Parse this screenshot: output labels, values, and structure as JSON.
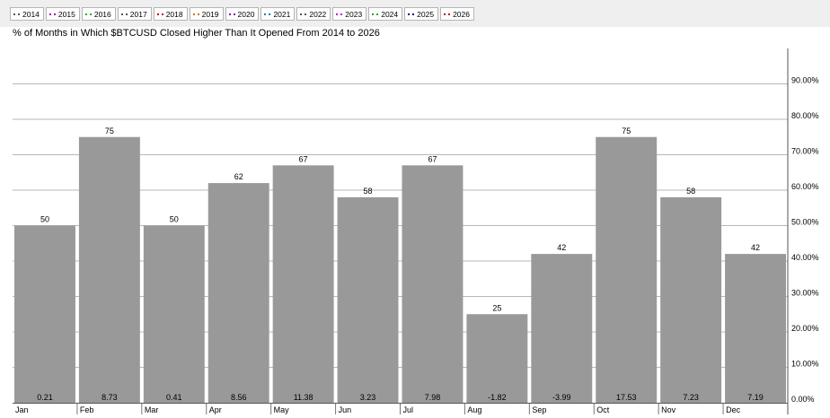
{
  "legend": [
    {
      "label": "2014",
      "color": "#555555"
    },
    {
      "label": "2015",
      "color": "#aa00aa"
    },
    {
      "label": "2016",
      "color": "#22aa22"
    },
    {
      "label": "2017",
      "color": "#555555"
    },
    {
      "label": "2018",
      "color": "#cc0000"
    },
    {
      "label": "2019",
      "color": "#cc7700"
    },
    {
      "label": "2020",
      "color": "#8800cc"
    },
    {
      "label": "2021",
      "color": "#008899"
    },
    {
      "label": "2022",
      "color": "#555555"
    },
    {
      "label": "2023",
      "color": "#cc00cc"
    },
    {
      "label": "2024",
      "color": "#22aa22"
    },
    {
      "label": "2025",
      "color": "#000088"
    },
    {
      "label": "2026",
      "color": "#cc0000"
    }
  ],
  "chart_data": {
    "type": "bar",
    "title": "% of Months in Which $BTCUSD Closed Higher Than It Opened From 2014 to 2026",
    "categories": [
      "Jan",
      "Feb",
      "Mar",
      "Apr",
      "May",
      "Jun",
      "Jul",
      "Aug",
      "Sep",
      "Oct",
      "Nov",
      "Dec"
    ],
    "values": [
      50,
      75,
      50,
      62,
      67,
      58,
      67,
      25,
      42,
      75,
      58,
      42
    ],
    "value_labels": [
      "50",
      "75",
      "50",
      "62",
      "67",
      "58",
      "67",
      "25",
      "42",
      "75",
      "58",
      "42"
    ],
    "inner_labels": [
      "0.21",
      "8.73",
      "0.41",
      "8.56",
      "11.38",
      "3.23",
      "7.98",
      "-1.82",
      "-3.99",
      "17.53",
      "7.23",
      "7.19"
    ],
    "y_ticks": [
      "0.00%",
      "10.00%",
      "20.00%",
      "30.00%",
      "40.00%",
      "50.00%",
      "60.00%",
      "70.00%",
      "80.00%",
      "90.00%"
    ],
    "ylim": [
      0,
      100
    ],
    "grid": true,
    "axis_position": "right",
    "bar_color": "#999999",
    "grid_color": "#b7b7b7"
  }
}
